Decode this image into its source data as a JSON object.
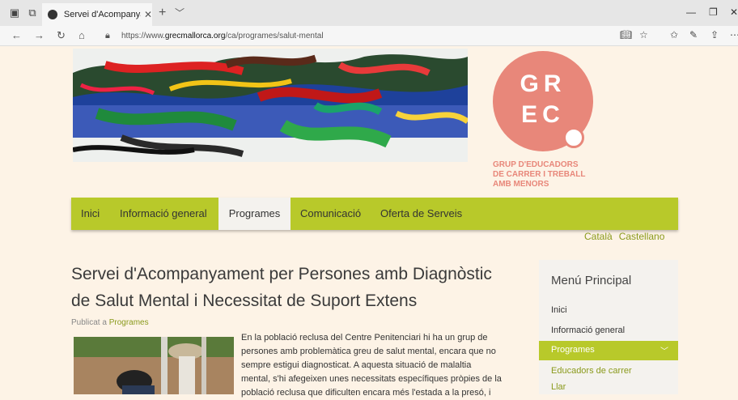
{
  "browser": {
    "tab_title": "Servei d'Acompanyame",
    "url_prefix": "https://www.",
    "url_domain": "grecmallorca.org",
    "url_path": "/ca/programes/salut-mental"
  },
  "logo": {
    "line1": "GR",
    "line2": "EC",
    "tagline1": "GRUP D'EDUCADORS",
    "tagline2": "DE CARRER I TREBALL",
    "tagline3": "AMB MENORS",
    "color": "#e8877a"
  },
  "menu": {
    "items": [
      {
        "label": "Inici"
      },
      {
        "label": "Informació general"
      },
      {
        "label": "Programes"
      },
      {
        "label": "Comunicació"
      },
      {
        "label": "Oferta de Serveis"
      }
    ],
    "active": "Programes",
    "color": "#b8c92a"
  },
  "languages": [
    "Català",
    "Castellano"
  ],
  "article": {
    "title_line1": "Servei d'Acompanyament per Persones amb Diagnòstic",
    "title_line2": "de Salut Mental i Necessitat de Suport Extens",
    "published_prefix": "Publicat a ",
    "published_category": "Programes",
    "body_lines": [
      "En la població reclusa del Centre Penitenciari hi ha un grup de",
      "persones amb problemàtica greu de salut mental, encara que no",
      "sempre estigui diagnosticat. A aquesta situació de malaltia",
      "mental, s'hi afegeixen unes necessitats específiques pròpies de la",
      "població reclusa que dificulten encara més l'estada a la presó, i"
    ]
  },
  "sidebar": {
    "title": "Menú Principal",
    "items": [
      "Inici",
      "Informació general"
    ],
    "active": "Programes",
    "sub_items": [
      "Educadors de carrer",
      "Llar"
    ]
  }
}
